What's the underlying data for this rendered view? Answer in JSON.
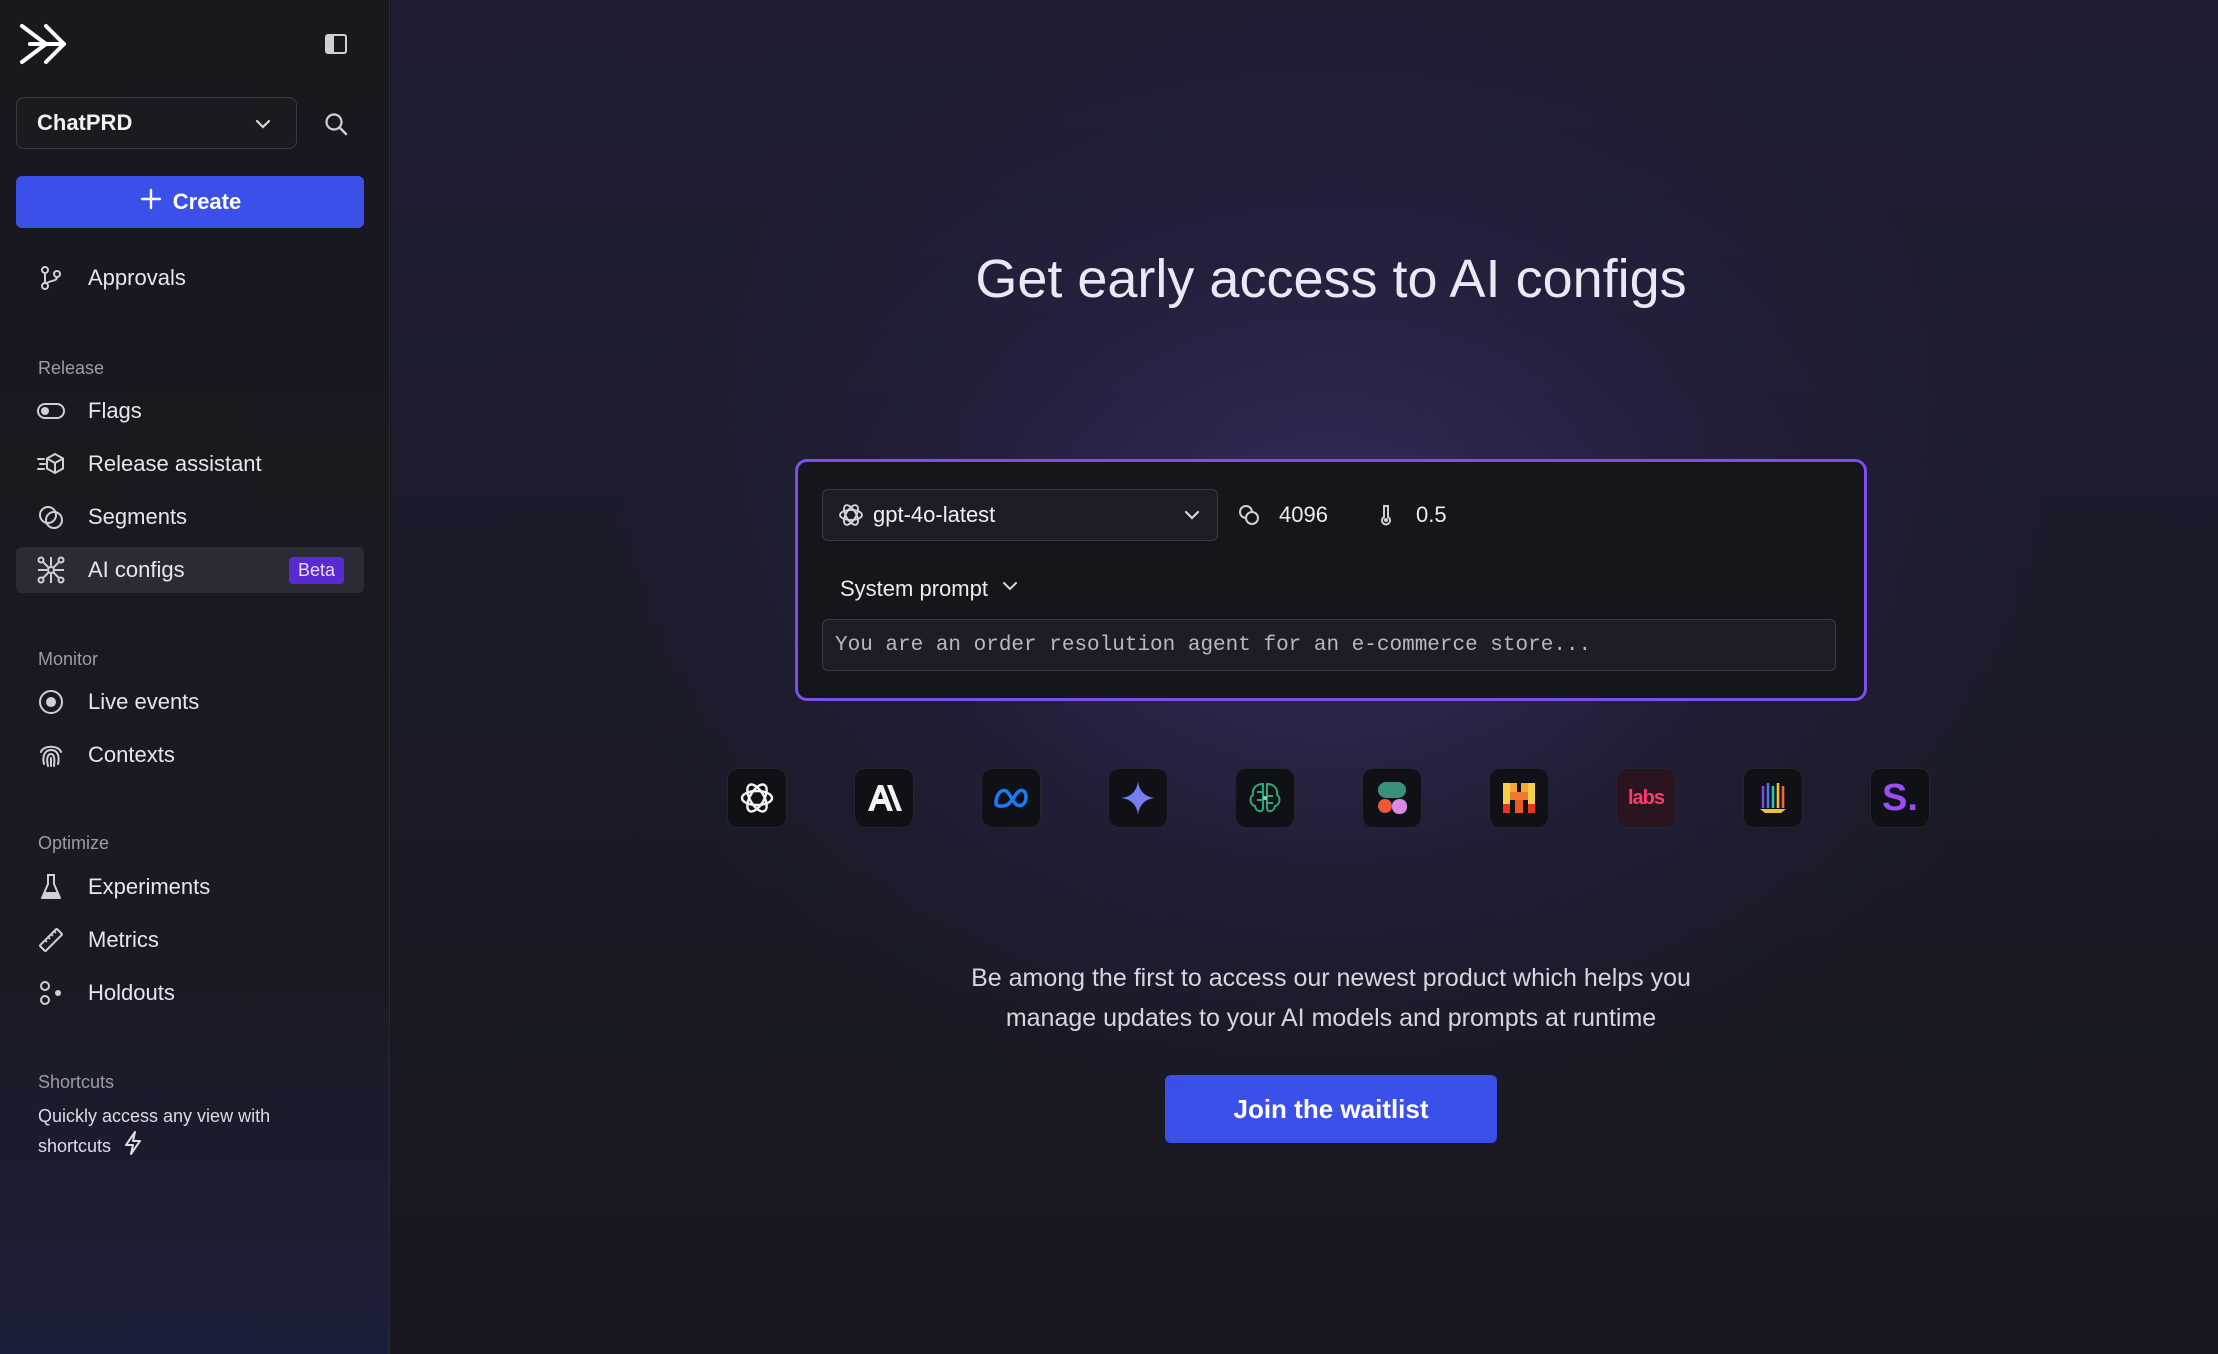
{
  "sidebar": {
    "project": "ChatPRD",
    "create_label": "Create",
    "top_items": [
      {
        "label": "Approvals",
        "icon": "git-branch-icon"
      }
    ],
    "sections": {
      "release": {
        "label": "Release",
        "items": [
          {
            "label": "Flags",
            "icon": "toggle-icon"
          },
          {
            "label": "Release assistant",
            "icon": "release-assistant-icon"
          },
          {
            "label": "Segments",
            "icon": "segments-icon"
          },
          {
            "label": "AI configs",
            "icon": "ai-configs-icon",
            "badge": "Beta",
            "active": true
          }
        ]
      },
      "monitor": {
        "label": "Monitor",
        "items": [
          {
            "label": "Live events",
            "icon": "live-events-icon"
          },
          {
            "label": "Contexts",
            "icon": "fingerprint-icon"
          }
        ]
      },
      "optimize": {
        "label": "Optimize",
        "items": [
          {
            "label": "Experiments",
            "icon": "flask-icon"
          },
          {
            "label": "Metrics",
            "icon": "ruler-icon"
          },
          {
            "label": "Holdouts",
            "icon": "holdouts-icon"
          }
        ]
      },
      "shortcuts": {
        "label": "Shortcuts",
        "text": "Quickly access any view with shortcuts"
      }
    }
  },
  "main": {
    "headline": "Get early access to AI configs",
    "config": {
      "model": "gpt-4o-latest",
      "max_tokens": "4096",
      "temperature": "0.5",
      "system_prompt_label": "System prompt",
      "prompt_text": "You are an order resolution agent for an e-commerce store..."
    },
    "providers": [
      "openai-icon",
      "anthropic-icon",
      "meta-icon",
      "gemini-icon",
      "cohere-brain-icon",
      "perplexity-icon",
      "mistral-icon",
      "labs-icon",
      "bars-icon",
      "s-icon"
    ],
    "provider_labels": {
      "labs": "labs",
      "s": "S."
    },
    "description_line1": "Be among the first to access our newest product which helps you",
    "description_line2": "manage updates to your AI models and prompts at runtime",
    "cta_label": "Join the waitlist"
  },
  "colors": {
    "accent": "#3b50e8",
    "card_border": "#7b4fe8",
    "beta": "#5a2ad1"
  }
}
